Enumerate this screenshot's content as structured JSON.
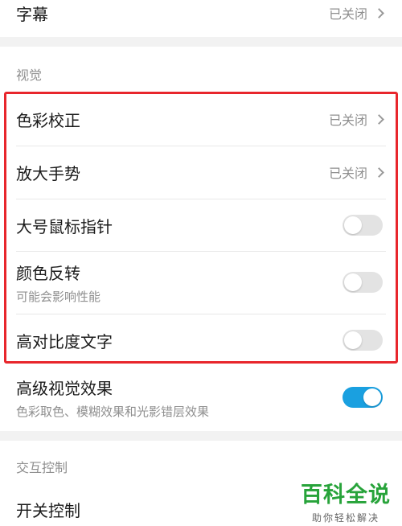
{
  "rows": {
    "subtitles": {
      "title": "字幕",
      "value": "已关闭"
    },
    "color_correction": {
      "title": "色彩校正",
      "value": "已关闭"
    },
    "magnify_gesture": {
      "title": "放大手势",
      "value": "已关闭"
    },
    "large_pointer": {
      "title": "大号鼠标指针",
      "enabled": false
    },
    "color_inversion": {
      "title": "颜色反转",
      "subtitle": "可能会影响性能",
      "enabled": false
    },
    "high_contrast": {
      "title": "高对比度文字",
      "enabled": false
    },
    "advanced_visual": {
      "title": "高级视觉效果",
      "subtitle": "色彩取色、模糊效果和光影错层效果",
      "enabled": true
    },
    "switch_control": {
      "title": "开关控制"
    }
  },
  "sections": {
    "vision": "视觉",
    "interaction": "交互控制"
  },
  "watermark": {
    "main": "百科全说",
    "sub": "助你轻松解决"
  },
  "colors": {
    "accent": "#1aa0e0",
    "highlight_border": "#e8262c",
    "watermark": "#27a33a"
  }
}
